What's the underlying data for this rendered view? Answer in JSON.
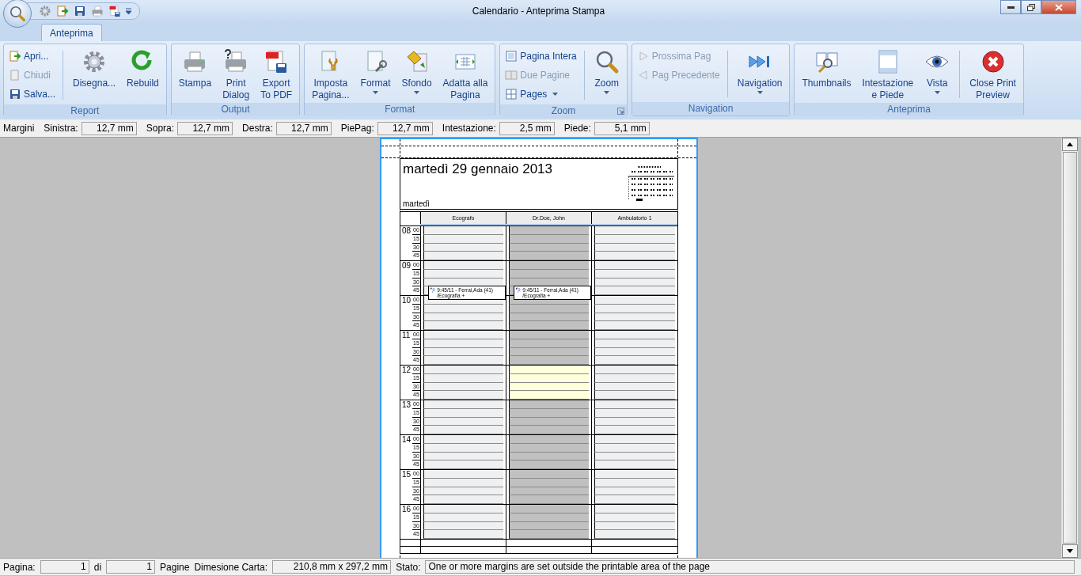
{
  "window": {
    "title": "Calendario - Anteprima Stampa"
  },
  "tabs": [
    {
      "label": "Anteprima",
      "selected": true
    }
  ],
  "ribbon": {
    "groups": [
      {
        "label": "Report",
        "items": [
          {
            "kind": "stack",
            "items": [
              {
                "label": "Apri...",
                "disabled": false
              },
              {
                "label": "Chiudi",
                "disabled": true
              },
              {
                "label": "Salva...",
                "disabled": false
              }
            ]
          },
          {
            "kind": "large",
            "label": "Disegna...",
            "separator_before": true
          },
          {
            "kind": "large",
            "label": "Rebuild"
          }
        ]
      },
      {
        "label": "Output",
        "items": [
          {
            "kind": "large",
            "label": "Stampa"
          },
          {
            "kind": "large",
            "label": "Print\nDialog"
          },
          {
            "kind": "large",
            "label": "Export\nTo PDF"
          }
        ]
      },
      {
        "label": "Format",
        "items": [
          {
            "kind": "large",
            "label": "Imposta\nPagina..."
          },
          {
            "kind": "large",
            "label": "Format",
            "dropdown": true
          },
          {
            "kind": "large",
            "label": "Sfondo",
            "dropdown": true
          },
          {
            "kind": "large",
            "label": "Adatta alla\nPagina"
          }
        ]
      },
      {
        "label": "Zoom",
        "launcher": true,
        "items": [
          {
            "kind": "stack",
            "items": [
              {
                "label": "Pagina Intera",
                "disabled": false
              },
              {
                "label": "Due Pagine",
                "disabled": true
              },
              {
                "label": "Pages",
                "disabled": false,
                "dropdown": true
              }
            ]
          },
          {
            "kind": "large",
            "label": "Zoom",
            "dropdown": true,
            "separator_before": true
          }
        ]
      },
      {
        "label": "Navigation",
        "items": [
          {
            "kind": "stack",
            "items": [
              {
                "label": "Prossima Pag",
                "disabled": true
              },
              {
                "label": "Pag Precedente",
                "disabled": true
              }
            ]
          },
          {
            "kind": "large",
            "label": "Navigation",
            "dropdown": true,
            "separator_before": true
          }
        ]
      },
      {
        "label": "Anteprima",
        "items": [
          {
            "kind": "large",
            "label": "Thumbnails"
          },
          {
            "kind": "large",
            "label": "Intestazione\ne Piede"
          },
          {
            "kind": "large",
            "label": "Vista",
            "dropdown": true
          },
          {
            "kind": "large",
            "label": "Close Print\nPreview",
            "separator_before": true
          }
        ]
      }
    ]
  },
  "margins": {
    "label": "Margini",
    "fields": [
      {
        "label": "Sinistra:",
        "value": "12,7 mm"
      },
      {
        "label": "Sopra:",
        "value": "12,7 mm"
      },
      {
        "label": "Destra:",
        "value": "12,7 mm"
      },
      {
        "label": "PiePag:",
        "value": "12,7 mm"
      },
      {
        "label": "Intestazione:",
        "value": "2,5 mm"
      },
      {
        "label": "Piede:",
        "value": "5,1 mm"
      }
    ]
  },
  "preview": {
    "title": "martedì 29 gennaio 2013",
    "subtitle": "martedì",
    "columns": [
      "Ecografo",
      "Dr.Doe, John",
      "Ambulatorio 1"
    ],
    "hours": [
      {
        "hour": "08",
        "quarters": [
          {
            "label": "00",
            "cells": [
              {
                "kind": "free"
              },
              {
                "kind": "unavailable"
              },
              {
                "kind": "free"
              }
            ]
          },
          {
            "label": "15",
            "cells": [
              {
                "kind": "free"
              },
              {
                "kind": "unavailable"
              },
              {
                "kind": "free"
              }
            ]
          },
          {
            "label": "30",
            "cells": [
              {
                "kind": "free"
              },
              {
                "kind": "unavailable"
              },
              {
                "kind": "free"
              }
            ]
          },
          {
            "label": "45",
            "cells": [
              {
                "kind": "free"
              },
              {
                "kind": "unavailable"
              },
              {
                "kind": "free"
              }
            ]
          }
        ]
      },
      {
        "hour": "09",
        "quarters": [
          {
            "label": "00",
            "cells": [
              {
                "kind": "free"
              },
              {
                "kind": "unavailable"
              },
              {
                "kind": "free"
              }
            ]
          },
          {
            "label": "15",
            "cells": [
              {
                "kind": "free"
              },
              {
                "kind": "unavailable"
              },
              {
                "kind": "free"
              }
            ]
          },
          {
            "label": "30",
            "cells": [
              {
                "kind": "free"
              },
              {
                "kind": "unavailable"
              },
              {
                "kind": "free"
              }
            ]
          },
          {
            "label": "45",
            "cells": [
              {
                "kind": "free",
                "appointment": "9:45/11 - Ferrai,Ada (41) /Ecografia +"
              },
              {
                "kind": "unavailable",
                "appointment": "9:45/11 - Ferrai,Ada (41) /Ecografia +"
              },
              {
                "kind": "free"
              }
            ]
          }
        ]
      },
      {
        "hour": "10",
        "quarters": [
          {
            "label": "00",
            "cells": [
              {
                "kind": "free"
              },
              {
                "kind": "unavailable"
              },
              {
                "kind": "free"
              }
            ]
          },
          {
            "label": "15",
            "cells": [
              {
                "kind": "free"
              },
              {
                "kind": "unavailable"
              },
              {
                "kind": "free"
              }
            ]
          },
          {
            "label": "30",
            "cells": [
              {
                "kind": "free"
              },
              {
                "kind": "unavailable"
              },
              {
                "kind": "free"
              }
            ]
          },
          {
            "label": "45",
            "cells": [
              {
                "kind": "free"
              },
              {
                "kind": "unavailable"
              },
              {
                "kind": "free"
              }
            ]
          }
        ]
      },
      {
        "hour": "11",
        "quarters": [
          {
            "label": "00",
            "cells": [
              {
                "kind": "free"
              },
              {
                "kind": "unavailable"
              },
              {
                "kind": "free"
              }
            ]
          },
          {
            "label": "15",
            "cells": [
              {
                "kind": "free"
              },
              {
                "kind": "unavailable"
              },
              {
                "kind": "free"
              }
            ]
          },
          {
            "label": "30",
            "cells": [
              {
                "kind": "free"
              },
              {
                "kind": "unavailable"
              },
              {
                "kind": "free"
              }
            ]
          },
          {
            "label": "45",
            "cells": [
              {
                "kind": "free"
              },
              {
                "kind": "unavailable"
              },
              {
                "kind": "free"
              }
            ]
          }
        ]
      },
      {
        "hour": "12",
        "quarters": [
          {
            "label": "00",
            "cells": [
              {
                "kind": "free"
              },
              {
                "kind": "available"
              },
              {
                "kind": "free"
              }
            ]
          },
          {
            "label": "15",
            "cells": [
              {
                "kind": "free"
              },
              {
                "kind": "available"
              },
              {
                "kind": "free"
              }
            ]
          },
          {
            "label": "30",
            "cells": [
              {
                "kind": "free"
              },
              {
                "kind": "available"
              },
              {
                "kind": "free"
              }
            ]
          },
          {
            "label": "45",
            "cells": [
              {
                "kind": "free"
              },
              {
                "kind": "available"
              },
              {
                "kind": "free"
              }
            ]
          }
        ]
      },
      {
        "hour": "13",
        "quarters": [
          {
            "label": "00",
            "cells": [
              {
                "kind": "free"
              },
              {
                "kind": "unavailable"
              },
              {
                "kind": "free"
              }
            ]
          },
          {
            "label": "15",
            "cells": [
              {
                "kind": "free"
              },
              {
                "kind": "unavailable"
              },
              {
                "kind": "free"
              }
            ]
          },
          {
            "label": "30",
            "cells": [
              {
                "kind": "free"
              },
              {
                "kind": "unavailable"
              },
              {
                "kind": "free"
              }
            ]
          },
          {
            "label": "45",
            "cells": [
              {
                "kind": "free"
              },
              {
                "kind": "unavailable"
              },
              {
                "kind": "free"
              }
            ]
          }
        ]
      },
      {
        "hour": "14",
        "quarters": [
          {
            "label": "00",
            "cells": [
              {
                "kind": "free"
              },
              {
                "kind": "unavailable"
              },
              {
                "kind": "free"
              }
            ]
          },
          {
            "label": "15",
            "cells": [
              {
                "kind": "free"
              },
              {
                "kind": "unavailable"
              },
              {
                "kind": "free"
              }
            ]
          },
          {
            "label": "30",
            "cells": [
              {
                "kind": "free"
              },
              {
                "kind": "unavailable"
              },
              {
                "kind": "free"
              }
            ]
          },
          {
            "label": "45",
            "cells": [
              {
                "kind": "free"
              },
              {
                "kind": "unavailable"
              },
              {
                "kind": "free"
              }
            ]
          }
        ]
      },
      {
        "hour": "15",
        "quarters": [
          {
            "label": "00",
            "cells": [
              {
                "kind": "free"
              },
              {
                "kind": "unavailable"
              },
              {
                "kind": "free"
              }
            ]
          },
          {
            "label": "15",
            "cells": [
              {
                "kind": "free"
              },
              {
                "kind": "unavailable"
              },
              {
                "kind": "free"
              }
            ]
          },
          {
            "label": "30",
            "cells": [
              {
                "kind": "free"
              },
              {
                "kind": "unavailable"
              },
              {
                "kind": "free"
              }
            ]
          },
          {
            "label": "45",
            "cells": [
              {
                "kind": "free"
              },
              {
                "kind": "unavailable"
              },
              {
                "kind": "free"
              }
            ]
          }
        ]
      },
      {
        "hour": "16",
        "quarters": [
          {
            "label": "00",
            "cells": [
              {
                "kind": "free"
              },
              {
                "kind": "unavailable"
              },
              {
                "kind": "free"
              }
            ]
          },
          {
            "label": "15",
            "cells": [
              {
                "kind": "free"
              },
              {
                "kind": "unavailable"
              },
              {
                "kind": "free"
              }
            ]
          },
          {
            "label": "30",
            "cells": [
              {
                "kind": "free"
              },
              {
                "kind": "unavailable"
              },
              {
                "kind": "free"
              }
            ]
          },
          {
            "label": "45",
            "cells": [
              {
                "kind": "free"
              },
              {
                "kind": "unavailable"
              },
              {
                "kind": "free"
              }
            ]
          }
        ]
      }
    ]
  },
  "status_bar": {
    "items": [
      {
        "kind": "label",
        "text": "Pagina:"
      },
      {
        "kind": "number",
        "value": "1"
      },
      {
        "kind": "label",
        "text": "di"
      },
      {
        "kind": "number",
        "value": "1"
      },
      {
        "kind": "label",
        "text": "Pagine"
      },
      {
        "kind": "label",
        "text": "Dimesione Carta:"
      },
      {
        "kind": "size",
        "value": "210,8 mm x 297,2 mm"
      },
      {
        "kind": "label",
        "text": "Stato:"
      },
      {
        "kind": "message",
        "value": "One or more margins are set outside the printable area of the page"
      }
    ]
  }
}
